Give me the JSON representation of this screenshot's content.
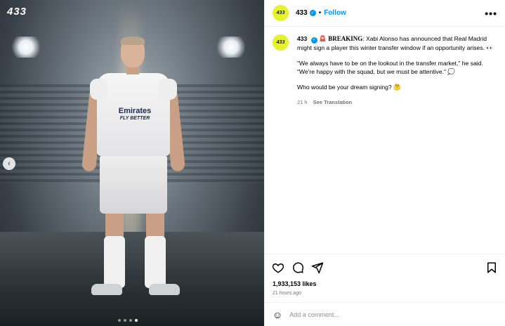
{
  "media": {
    "brand_logo": "433",
    "prev_icon": "‹",
    "shirt_sponsor": "Emirates",
    "shirt_slogan": "FLY BETTER",
    "carousel_dots": [
      false,
      false,
      false,
      true
    ]
  },
  "header": {
    "avatar_text": "433",
    "username": "433",
    "separator": "•",
    "follow_label": "Follow",
    "more_icon": "•••"
  },
  "caption": {
    "avatar_text": "433",
    "username": "433",
    "siren_emoji": "🚨",
    "breaking": "BREAKING",
    "text1": ": Xabi Alonso has announced that Real Madrid might sign a player this winter transfer window if an opportunity arises. 👀",
    "quote": "\"We always have to be on the lookout in the transfer market,\" he said. \"We're happy with the squad, but we must be attentive.\" 💭",
    "question": "Who would be your dream signing? 🤔",
    "age": "21 h",
    "see_translation": "See Translation"
  },
  "stats": {
    "likes": "1,933,153 likes",
    "time_ago": "21 hours ago"
  },
  "comment": {
    "emoji_icon": "☺",
    "placeholder": "Add a comment..."
  },
  "icons": [
    "heart-icon",
    "comment-icon",
    "share-icon",
    "bookmark-icon",
    "verified-badge-icon",
    "more-icon",
    "emoji-icon",
    "chevron-left-icon"
  ]
}
